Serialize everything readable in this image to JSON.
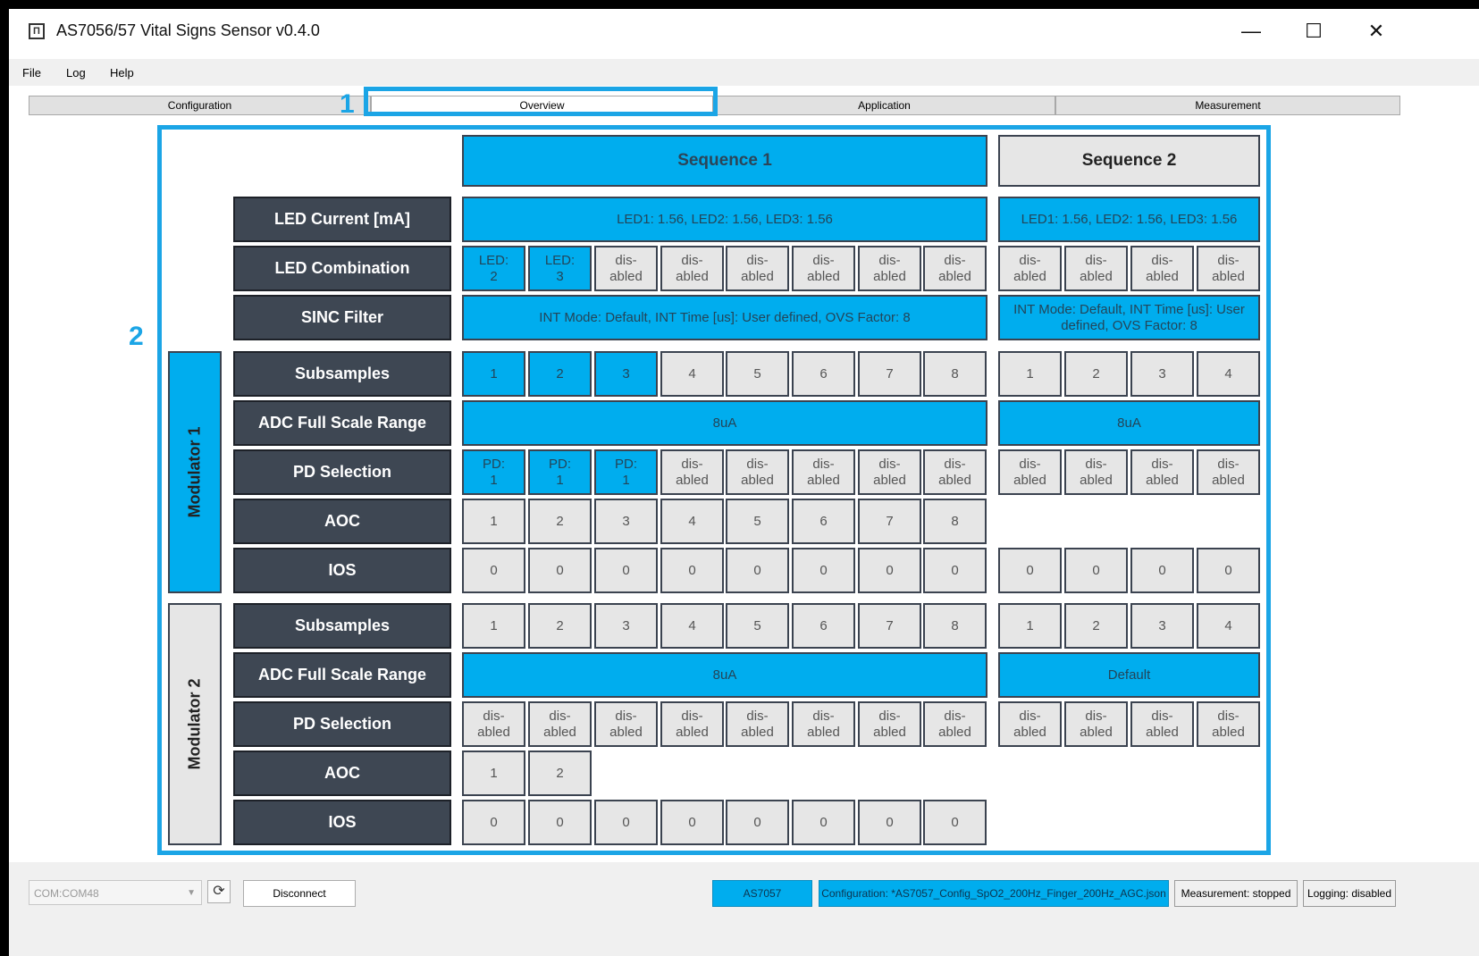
{
  "window": {
    "title": "AS7056/57 Vital Signs Sensor  v0.4.0",
    "minimize_label": "—",
    "maximize_label": "☐",
    "close_label": "✕"
  },
  "menu": {
    "items": [
      "File",
      "Log",
      "Help"
    ]
  },
  "tabs": [
    {
      "label": "Configuration",
      "active": false
    },
    {
      "label": "Overview",
      "active": true
    },
    {
      "label": "Application",
      "active": false
    },
    {
      "label": "Measurement",
      "active": false
    }
  ],
  "callouts": [
    "1",
    "2"
  ],
  "overview": {
    "sequence1_header": "Sequence 1",
    "sequence2_header": "Sequence 2",
    "modulator1_label": "Modulator 1",
    "modulator2_label": "Modulator 2",
    "rows": [
      {
        "label": "LED Current [mA]",
        "s1": {
          "type": "span",
          "text": "LED1: 1.56, LED2: 1.56, LED3: 1.56",
          "blue": true
        },
        "s2": {
          "type": "span",
          "text": "LED1: 1.56, LED2: 1.56, LED3: 1.56",
          "blue": true
        }
      },
      {
        "label": "LED Combination",
        "s1": {
          "type": "cells",
          "cells": [
            {
              "text": "LED:\n2",
              "blue": true
            },
            {
              "text": "LED:\n3",
              "blue": true
            },
            {
              "text": "dis-\nabled"
            },
            {
              "text": "dis-\nabled"
            },
            {
              "text": "dis-\nabled"
            },
            {
              "text": "dis-\nabled"
            },
            {
              "text": "dis-\nabled"
            },
            {
              "text": "dis-\nabled"
            }
          ]
        },
        "s2": {
          "type": "cells",
          "cells": [
            {
              "text": "dis-\nabled"
            },
            {
              "text": "dis-\nabled"
            },
            {
              "text": "dis-\nabled"
            },
            {
              "text": "dis-\nabled"
            }
          ]
        }
      },
      {
        "label": "SINC Filter",
        "s1": {
          "type": "span",
          "text": "INT Mode: Default, INT Time [us]: User defined, OVS Factor: 8",
          "blue": true
        },
        "s2": {
          "type": "span",
          "text": "INT Mode: Default, INT Time [us]: User defined, OVS Factor: 8",
          "blue": true
        }
      },
      {
        "label": "Subsamples",
        "s1": {
          "type": "cells",
          "cells": [
            {
              "text": "1",
              "blue": true
            },
            {
              "text": "2",
              "blue": true
            },
            {
              "text": "3",
              "blue": true
            },
            {
              "text": "4"
            },
            {
              "text": "5"
            },
            {
              "text": "6"
            },
            {
              "text": "7"
            },
            {
              "text": "8"
            }
          ]
        },
        "s2": {
          "type": "cells",
          "cells": [
            {
              "text": "1"
            },
            {
              "text": "2"
            },
            {
              "text": "3"
            },
            {
              "text": "4"
            }
          ]
        }
      },
      {
        "label": "ADC Full Scale Range",
        "s1": {
          "type": "span",
          "text": "8uA",
          "blue": true
        },
        "s2": {
          "type": "span",
          "text": "8uA",
          "blue": true
        }
      },
      {
        "label": "PD Selection",
        "s1": {
          "type": "cells",
          "cells": [
            {
              "text": "PD:\n1",
              "blue": true
            },
            {
              "text": "PD:\n1",
              "blue": true
            },
            {
              "text": "PD:\n1",
              "blue": true
            },
            {
              "text": "dis-\nabled"
            },
            {
              "text": "dis-\nabled"
            },
            {
              "text": "dis-\nabled"
            },
            {
              "text": "dis-\nabled"
            },
            {
              "text": "dis-\nabled"
            }
          ]
        },
        "s2": {
          "type": "cells",
          "cells": [
            {
              "text": "dis-\nabled"
            },
            {
              "text": "dis-\nabled"
            },
            {
              "text": "dis-\nabled"
            },
            {
              "text": "dis-\nabled"
            }
          ]
        }
      },
      {
        "label": "AOC",
        "s1": {
          "type": "cells",
          "cells": [
            {
              "text": "1"
            },
            {
              "text": "2"
            },
            {
              "text": "3"
            },
            {
              "text": "4"
            },
            {
              "text": "5"
            },
            {
              "text": "6"
            },
            {
              "text": "7"
            },
            {
              "text": "8"
            }
          ]
        },
        "s2": {
          "type": "none"
        }
      },
      {
        "label": "IOS",
        "s1": {
          "type": "cells",
          "cells": [
            {
              "text": "0"
            },
            {
              "text": "0"
            },
            {
              "text": "0"
            },
            {
              "text": "0"
            },
            {
              "text": "0"
            },
            {
              "text": "0"
            },
            {
              "text": "0"
            },
            {
              "text": "0"
            }
          ]
        },
        "s2": {
          "type": "cells",
          "cells": [
            {
              "text": "0"
            },
            {
              "text": "0"
            },
            {
              "text": "0"
            },
            {
              "text": "0"
            }
          ]
        }
      },
      {
        "label": "Subsamples",
        "s1": {
          "type": "cells",
          "cells": [
            {
              "text": "1"
            },
            {
              "text": "2"
            },
            {
              "text": "3"
            },
            {
              "text": "4"
            },
            {
              "text": "5"
            },
            {
              "text": "6"
            },
            {
              "text": "7"
            },
            {
              "text": "8"
            }
          ]
        },
        "s2": {
          "type": "cells",
          "cells": [
            {
              "text": "1"
            },
            {
              "text": "2"
            },
            {
              "text": "3"
            },
            {
              "text": "4"
            }
          ]
        }
      },
      {
        "label": "ADC Full Scale Range",
        "s1": {
          "type": "span",
          "text": "8uA",
          "blue": true
        },
        "s2": {
          "type": "span",
          "text": "Default",
          "blue": true
        }
      },
      {
        "label": "PD Selection",
        "s1": {
          "type": "cells",
          "cells": [
            {
              "text": "dis-\nabled"
            },
            {
              "text": "dis-\nabled"
            },
            {
              "text": "dis-\nabled"
            },
            {
              "text": "dis-\nabled"
            },
            {
              "text": "dis-\nabled"
            },
            {
              "text": "dis-\nabled"
            },
            {
              "text": "dis-\nabled"
            },
            {
              "text": "dis-\nabled"
            }
          ]
        },
        "s2": {
          "type": "cells",
          "cells": [
            {
              "text": "dis-\nabled"
            },
            {
              "text": "dis-\nabled"
            },
            {
              "text": "dis-\nabled"
            },
            {
              "text": "dis-\nabled"
            }
          ]
        }
      },
      {
        "label": "AOC",
        "s1": {
          "type": "cells",
          "cells": [
            {
              "text": "1"
            },
            {
              "text": "2"
            }
          ]
        },
        "s2": {
          "type": "none"
        }
      },
      {
        "label": "IOS",
        "s1": {
          "type": "cells",
          "cells": [
            {
              "text": "0"
            },
            {
              "text": "0"
            },
            {
              "text": "0"
            },
            {
              "text": "0"
            },
            {
              "text": "0"
            },
            {
              "text": "0"
            },
            {
              "text": "0"
            },
            {
              "text": "0"
            }
          ]
        },
        "s2": {
          "type": "none"
        }
      }
    ]
  },
  "status": {
    "port": "COM:COM48",
    "disconnect_label": "Disconnect",
    "device": "AS7057",
    "configuration": "Configuration: *AS7057_Config_SpO2_200Hz_Finger_200Hz_AGC.json",
    "measurement": "Measurement: stopped",
    "logging": "Logging: disabled"
  },
  "colors": {
    "accent": "#00adee",
    "label_bg": "#3e4753",
    "cell_grey": "#e6e6e6",
    "highlight": "#1ba5e6"
  }
}
